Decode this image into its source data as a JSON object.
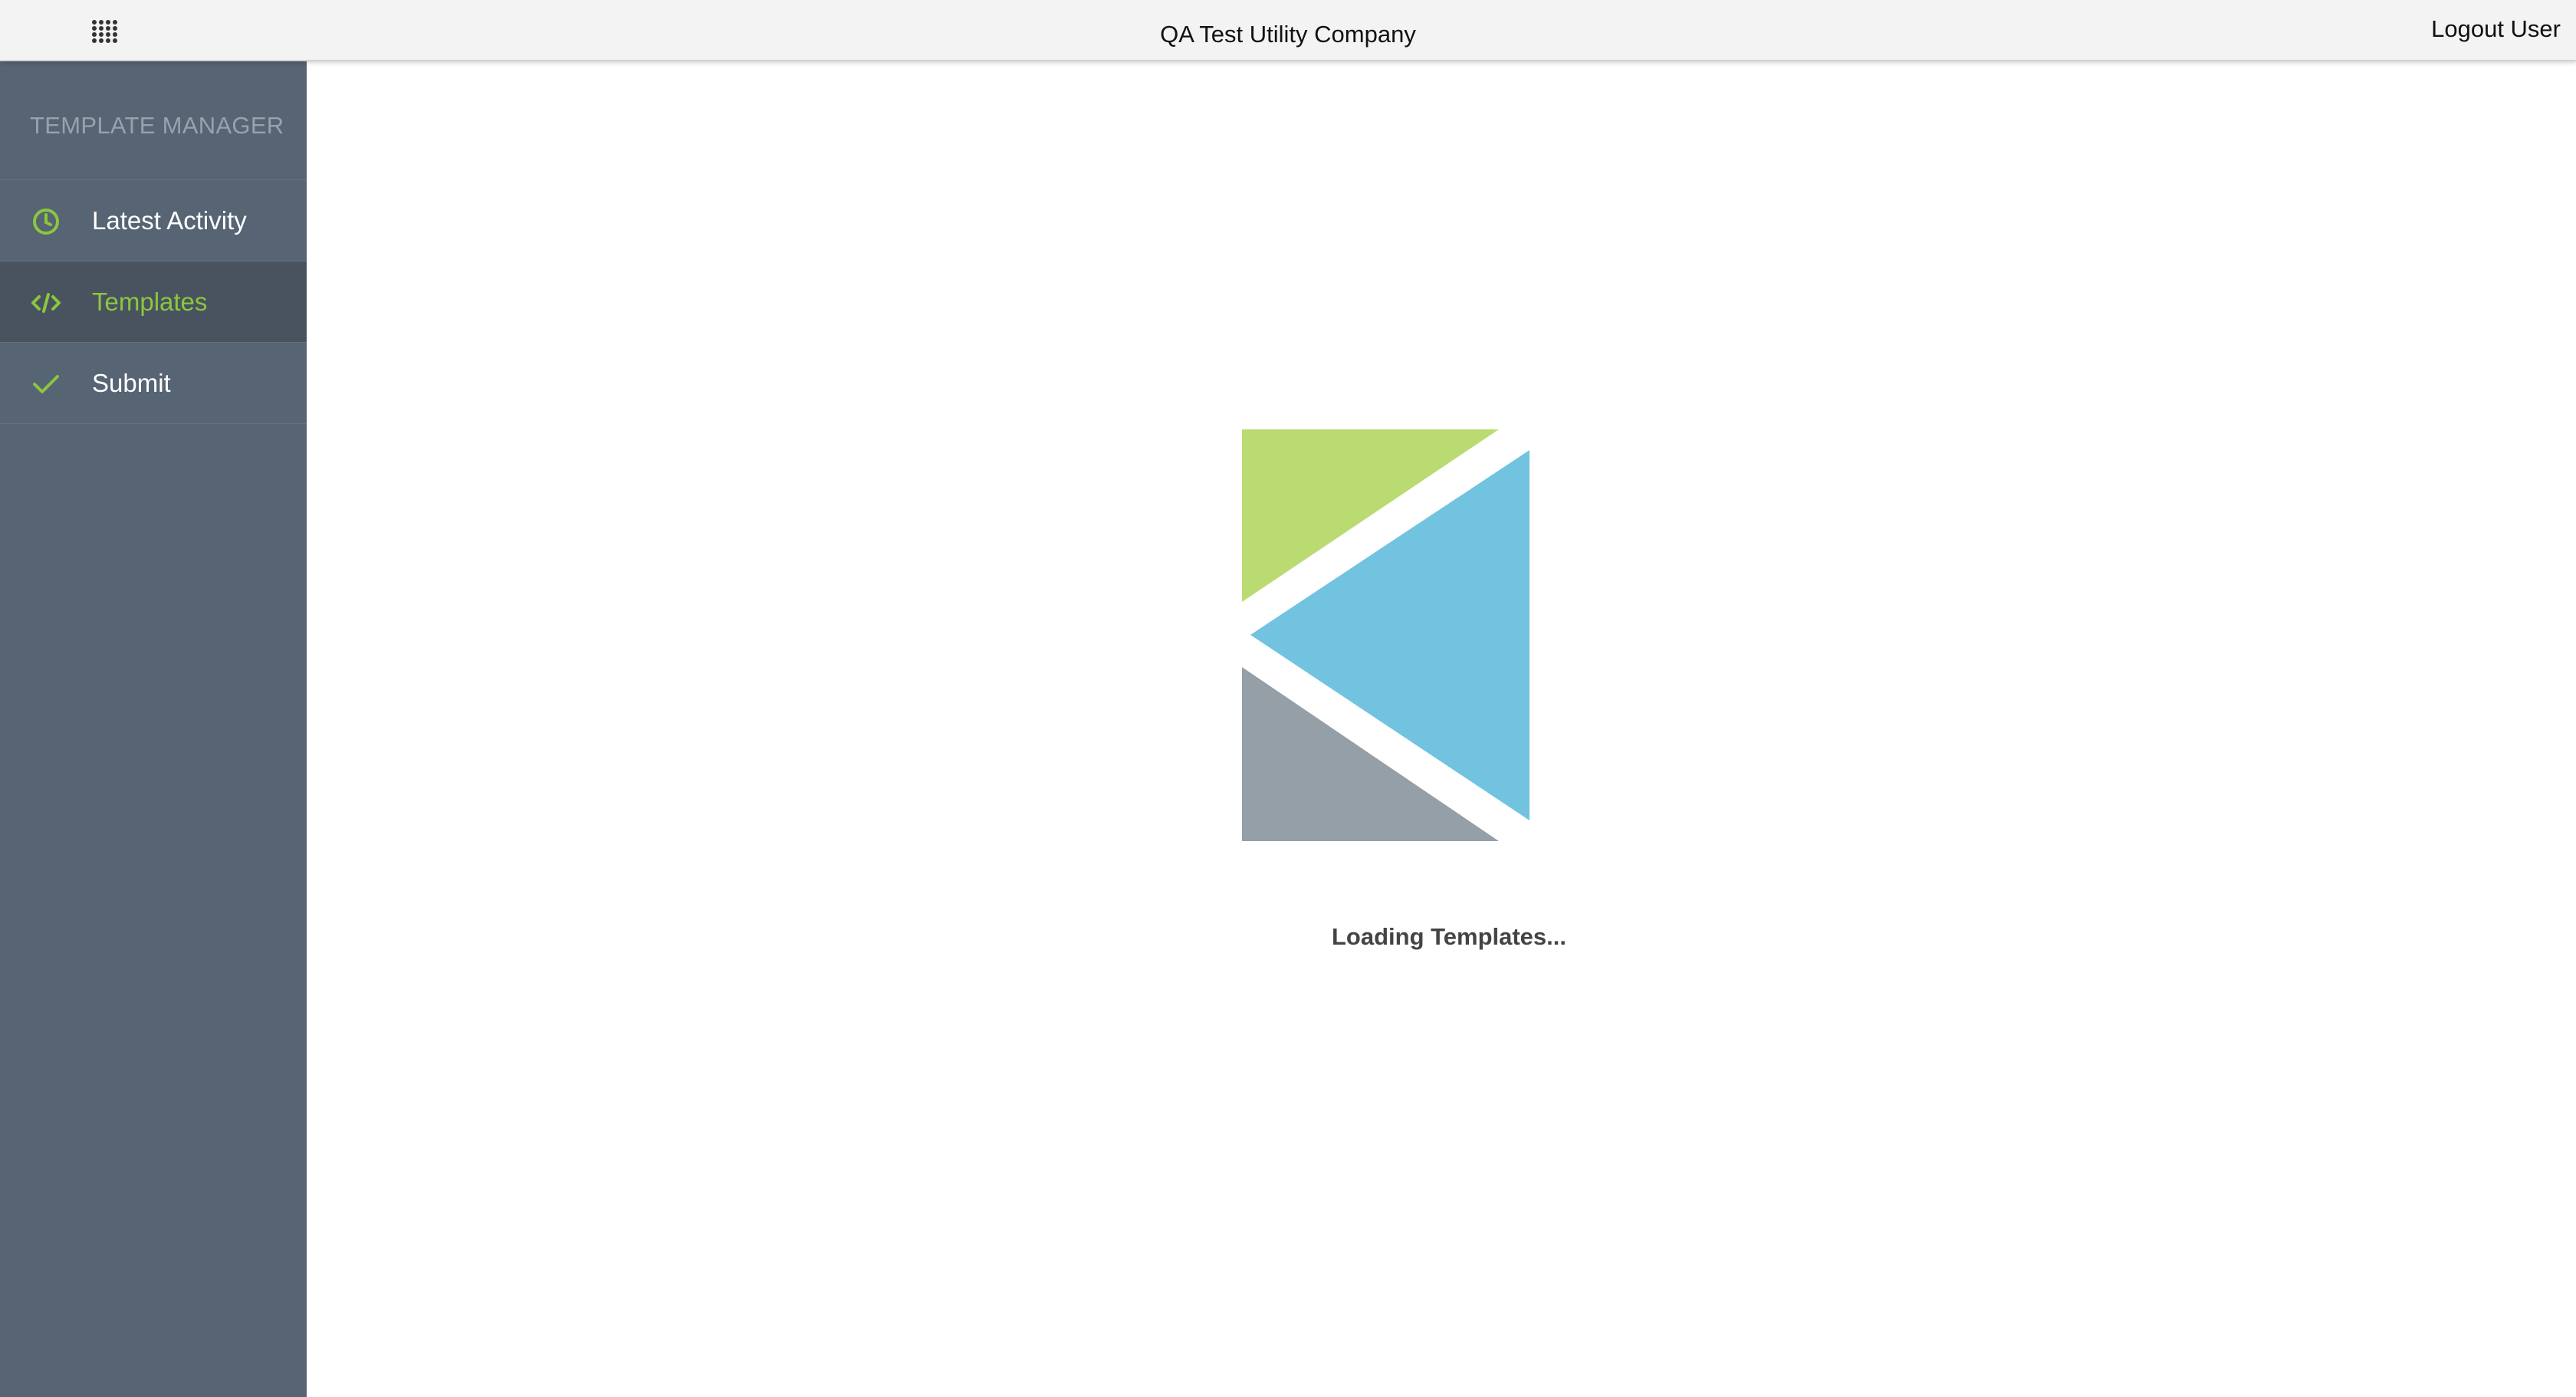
{
  "header": {
    "company_name": "QA Test Utility Company",
    "logout_label": "Logout User",
    "apps_icon": "grid-icon"
  },
  "sidebar": {
    "title": "TEMPLATE MANAGER",
    "items": [
      {
        "label": "Latest Activity",
        "icon": "clock-icon",
        "active": false
      },
      {
        "label": "Templates",
        "icon": "code-icon",
        "active": true
      },
      {
        "label": "Submit",
        "icon": "check-icon",
        "active": false
      }
    ]
  },
  "main": {
    "loading_text": "Loading Templates..."
  },
  "colors": {
    "accent": "#8cc63f",
    "sidebar_bg": "#566473",
    "sidebar_active_bg": "#48535f",
    "logo_green": "#b9db72",
    "logo_blue": "#72c3e0",
    "logo_gray": "#959fa8"
  }
}
